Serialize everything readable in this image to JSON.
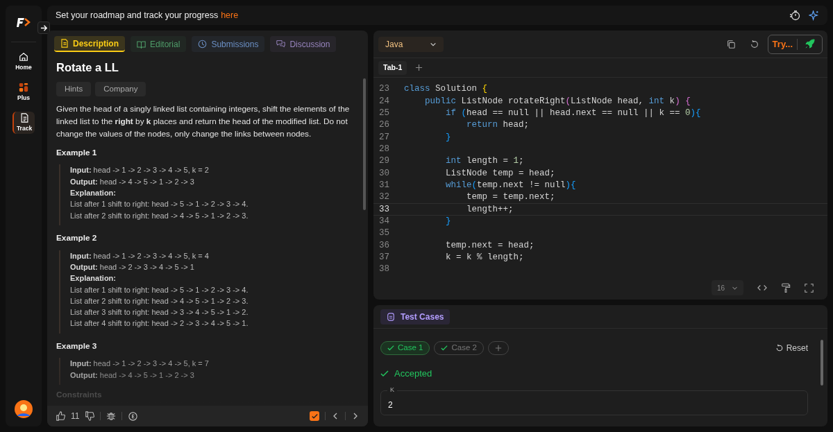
{
  "sidebar": {
    "items": [
      {
        "label": "Home",
        "selected": false
      },
      {
        "label": "Plus",
        "selected": false
      },
      {
        "label": "Track",
        "selected": true
      }
    ]
  },
  "banner": {
    "text": "Set your roadmap and track your progress",
    "link": "here"
  },
  "problem": {
    "tabs": [
      {
        "label": "Description",
        "color": "#facc15",
        "selected": true
      },
      {
        "label": "Editorial",
        "color": "#4f9d69",
        "selected": false
      },
      {
        "label": "Submissions",
        "color": "#6b8fc4",
        "selected": false
      },
      {
        "label": "Discussion",
        "color": "#9784bd",
        "selected": false
      }
    ],
    "title": "Rotate a LL",
    "chips": [
      "Hints",
      "Company"
    ],
    "statement": "Given the head of a singly linked list containing integers, shift the elements of the linked list to the **right** by **k** places and return the head of the modified list. Do not change the values of the nodes, only change the links between nodes.",
    "examples": [
      {
        "title": "Example 1",
        "lines": [
          "**Input:** head -> 1 -> 2 -> 3 -> 4 -> 5, k = 2",
          "**Output:** head -> 4 -> 5 -> 1 -> 2 -> 3",
          "**Explanation:**",
          "List after 1 shift to right: head -> 5 -> 1 -> 2 -> 3 -> 4.",
          "List after 2 shift to right: head -> 4 -> 5 -> 1 -> 2 -> 3."
        ]
      },
      {
        "title": "Example 2",
        "lines": [
          "**Input:** head -> 1 -> 2 -> 3 -> 4 -> 5, k = 4",
          "**Output:** head -> 2 -> 3 -> 4 -> 5 -> 1",
          "**Explanation:**",
          "List after 1 shift to right: head -> 5 -> 1 -> 2 -> 3 -> 4.",
          "List after 2 shift to right: head -> 4 -> 5 -> 1 -> 2 -> 3.",
          "List after 3 shift to right: head -> 3 -> 4 -> 5 -> 1 -> 2.",
          "List after 4 shift to right: head -> 2 -> 3 -> 4 -> 5 -> 1."
        ]
      },
      {
        "title": "Example 3",
        "lines": [
          "**Input:** head -> 1 -> 2 -> 3 -> 4 -> 5, k = 7",
          "**Output:**  head -> 4 -> 5 -> 1 -> 2 -> 3"
        ]
      }
    ],
    "next_heading": "Constraints",
    "footer": {
      "likes": "11",
      "solved": true
    }
  },
  "editor": {
    "language": "Java",
    "run_button": "Try...",
    "tabs": [
      {
        "label": "Tab-1",
        "selected": true
      }
    ],
    "lines": [
      {
        "number": "23",
        "current": false,
        "tokens": [
          {
            "text": "class ",
            "kind": "keyword"
          },
          {
            "text": "Solution ",
            "kind": "plain"
          },
          {
            "text": "{",
            "kind": "brace1"
          }
        ]
      },
      {
        "number": "24",
        "current": false,
        "tokens": [
          {
            "text": "    public ",
            "kind": "keyword"
          },
          {
            "text": "ListNode rotateRight",
            "kind": "plain"
          },
          {
            "text": "(",
            "kind": "brace2"
          },
          {
            "text": "ListNode head, ",
            "kind": "plain"
          },
          {
            "text": "int ",
            "kind": "keyword"
          },
          {
            "text": "k",
            "kind": "plain"
          },
          {
            "text": ") {",
            "kind": "brace2"
          }
        ]
      },
      {
        "number": "25",
        "current": false,
        "tokens": [
          {
            "text": "        if ",
            "kind": "keyword"
          },
          {
            "text": "(",
            "kind": "brace3"
          },
          {
            "text": "head == null || head.next == null || k == ",
            "kind": "plain"
          },
          {
            "text": "0",
            "kind": "number"
          },
          {
            "text": "){",
            "kind": "brace3"
          }
        ]
      },
      {
        "number": "26",
        "current": false,
        "tokens": [
          {
            "text": "            return ",
            "kind": "keyword"
          },
          {
            "text": "head;",
            "kind": "plain"
          }
        ]
      },
      {
        "number": "27",
        "current": false,
        "tokens": [
          {
            "text": "        }",
            "kind": "brace3"
          }
        ]
      },
      {
        "number": "28",
        "current": false
      },
      {
        "number": "29",
        "current": false,
        "tokens": [
          {
            "text": "        int ",
            "kind": "keyword"
          },
          {
            "text": "length = ",
            "kind": "plain"
          },
          {
            "text": "1",
            "kind": "number"
          },
          {
            "text": ";",
            "kind": "plain"
          }
        ]
      },
      {
        "number": "30",
        "current": false,
        "tokens": [
          {
            "text": "        ListNode temp = head;",
            "kind": "plain"
          }
        ]
      },
      {
        "number": "31",
        "current": false,
        "tokens": [
          {
            "text": "        while",
            "kind": "keyword"
          },
          {
            "text": "(",
            "kind": "brace3"
          },
          {
            "text": "temp.next != null",
            "kind": "plain"
          },
          {
            "text": "){",
            "kind": "brace3"
          }
        ]
      },
      {
        "number": "32",
        "current": false,
        "tokens": [
          {
            "text": "            temp = temp.next;",
            "kind": "plain"
          }
        ]
      },
      {
        "number": "33",
        "current": true,
        "tokens": [
          {
            "text": "            length++;",
            "kind": "plain"
          }
        ]
      },
      {
        "number": "34",
        "current": false,
        "tokens": [
          {
            "text": "        }",
            "kind": "brace3"
          }
        ]
      },
      {
        "number": "35",
        "current": false
      },
      {
        "number": "36",
        "current": false,
        "tokens": [
          {
            "text": "        temp.next = head;",
            "kind": "plain"
          }
        ]
      },
      {
        "number": "37",
        "current": false,
        "tokens": [
          {
            "text": "        k = k % length;",
            "kind": "plain"
          }
        ]
      },
      {
        "number": "38",
        "current": false
      }
    ],
    "font_size": "16"
  },
  "tests": {
    "tab": "Test Cases",
    "cases": [
      {
        "label": "Case 1",
        "selected": true
      },
      {
        "label": "Case 2",
        "selected": false
      }
    ],
    "reset": "Reset",
    "verdict": "Accepted",
    "input": {
      "label": "K",
      "value": "2"
    }
  }
}
